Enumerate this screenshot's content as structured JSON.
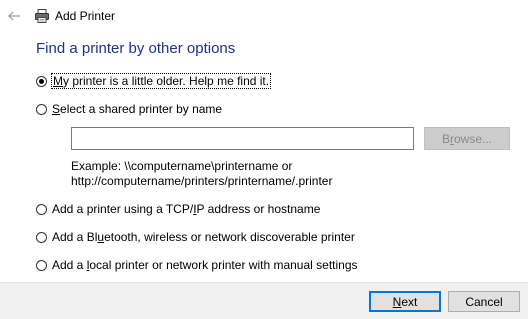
{
  "window": {
    "title": "Add Printer"
  },
  "page": {
    "heading": "Find a printer by other options"
  },
  "options": [
    {
      "label_pre": "",
      "label_u": "M",
      "label_post": "y printer is a little older. Help me find it.",
      "checked": true
    },
    {
      "label_pre": "",
      "label_u": "S",
      "label_post": "elect a shared printer by name",
      "checked": false
    },
    {
      "label_pre": "Add a printer using a TCP/",
      "label_u": "I",
      "label_post": "P address or hostname",
      "checked": false
    },
    {
      "label_pre": "Add a Bl",
      "label_u": "u",
      "label_post": "etooth, wireless or network discoverable printer",
      "checked": false
    },
    {
      "label_pre": "Add a ",
      "label_u": "l",
      "label_post": "ocal printer or network printer with manual settings",
      "checked": false
    }
  ],
  "shared": {
    "input_value": "",
    "browse_label_pre": "B",
    "browse_label_u": "r",
    "browse_label_post": "owse...",
    "example_line1": "Example: \\\\computername\\printername or",
    "example_line2": "http://computername/printers/printername/.printer"
  },
  "footer": {
    "next_u": "N",
    "next_post": "ext",
    "cancel_label": "Cancel"
  },
  "colors": {
    "heading": "#1e3287",
    "default_button_border": "#0078d7",
    "footer_bg": "#f0f0f0"
  },
  "icons": {
    "back": "back-arrow-icon",
    "printer": "printer-icon"
  }
}
